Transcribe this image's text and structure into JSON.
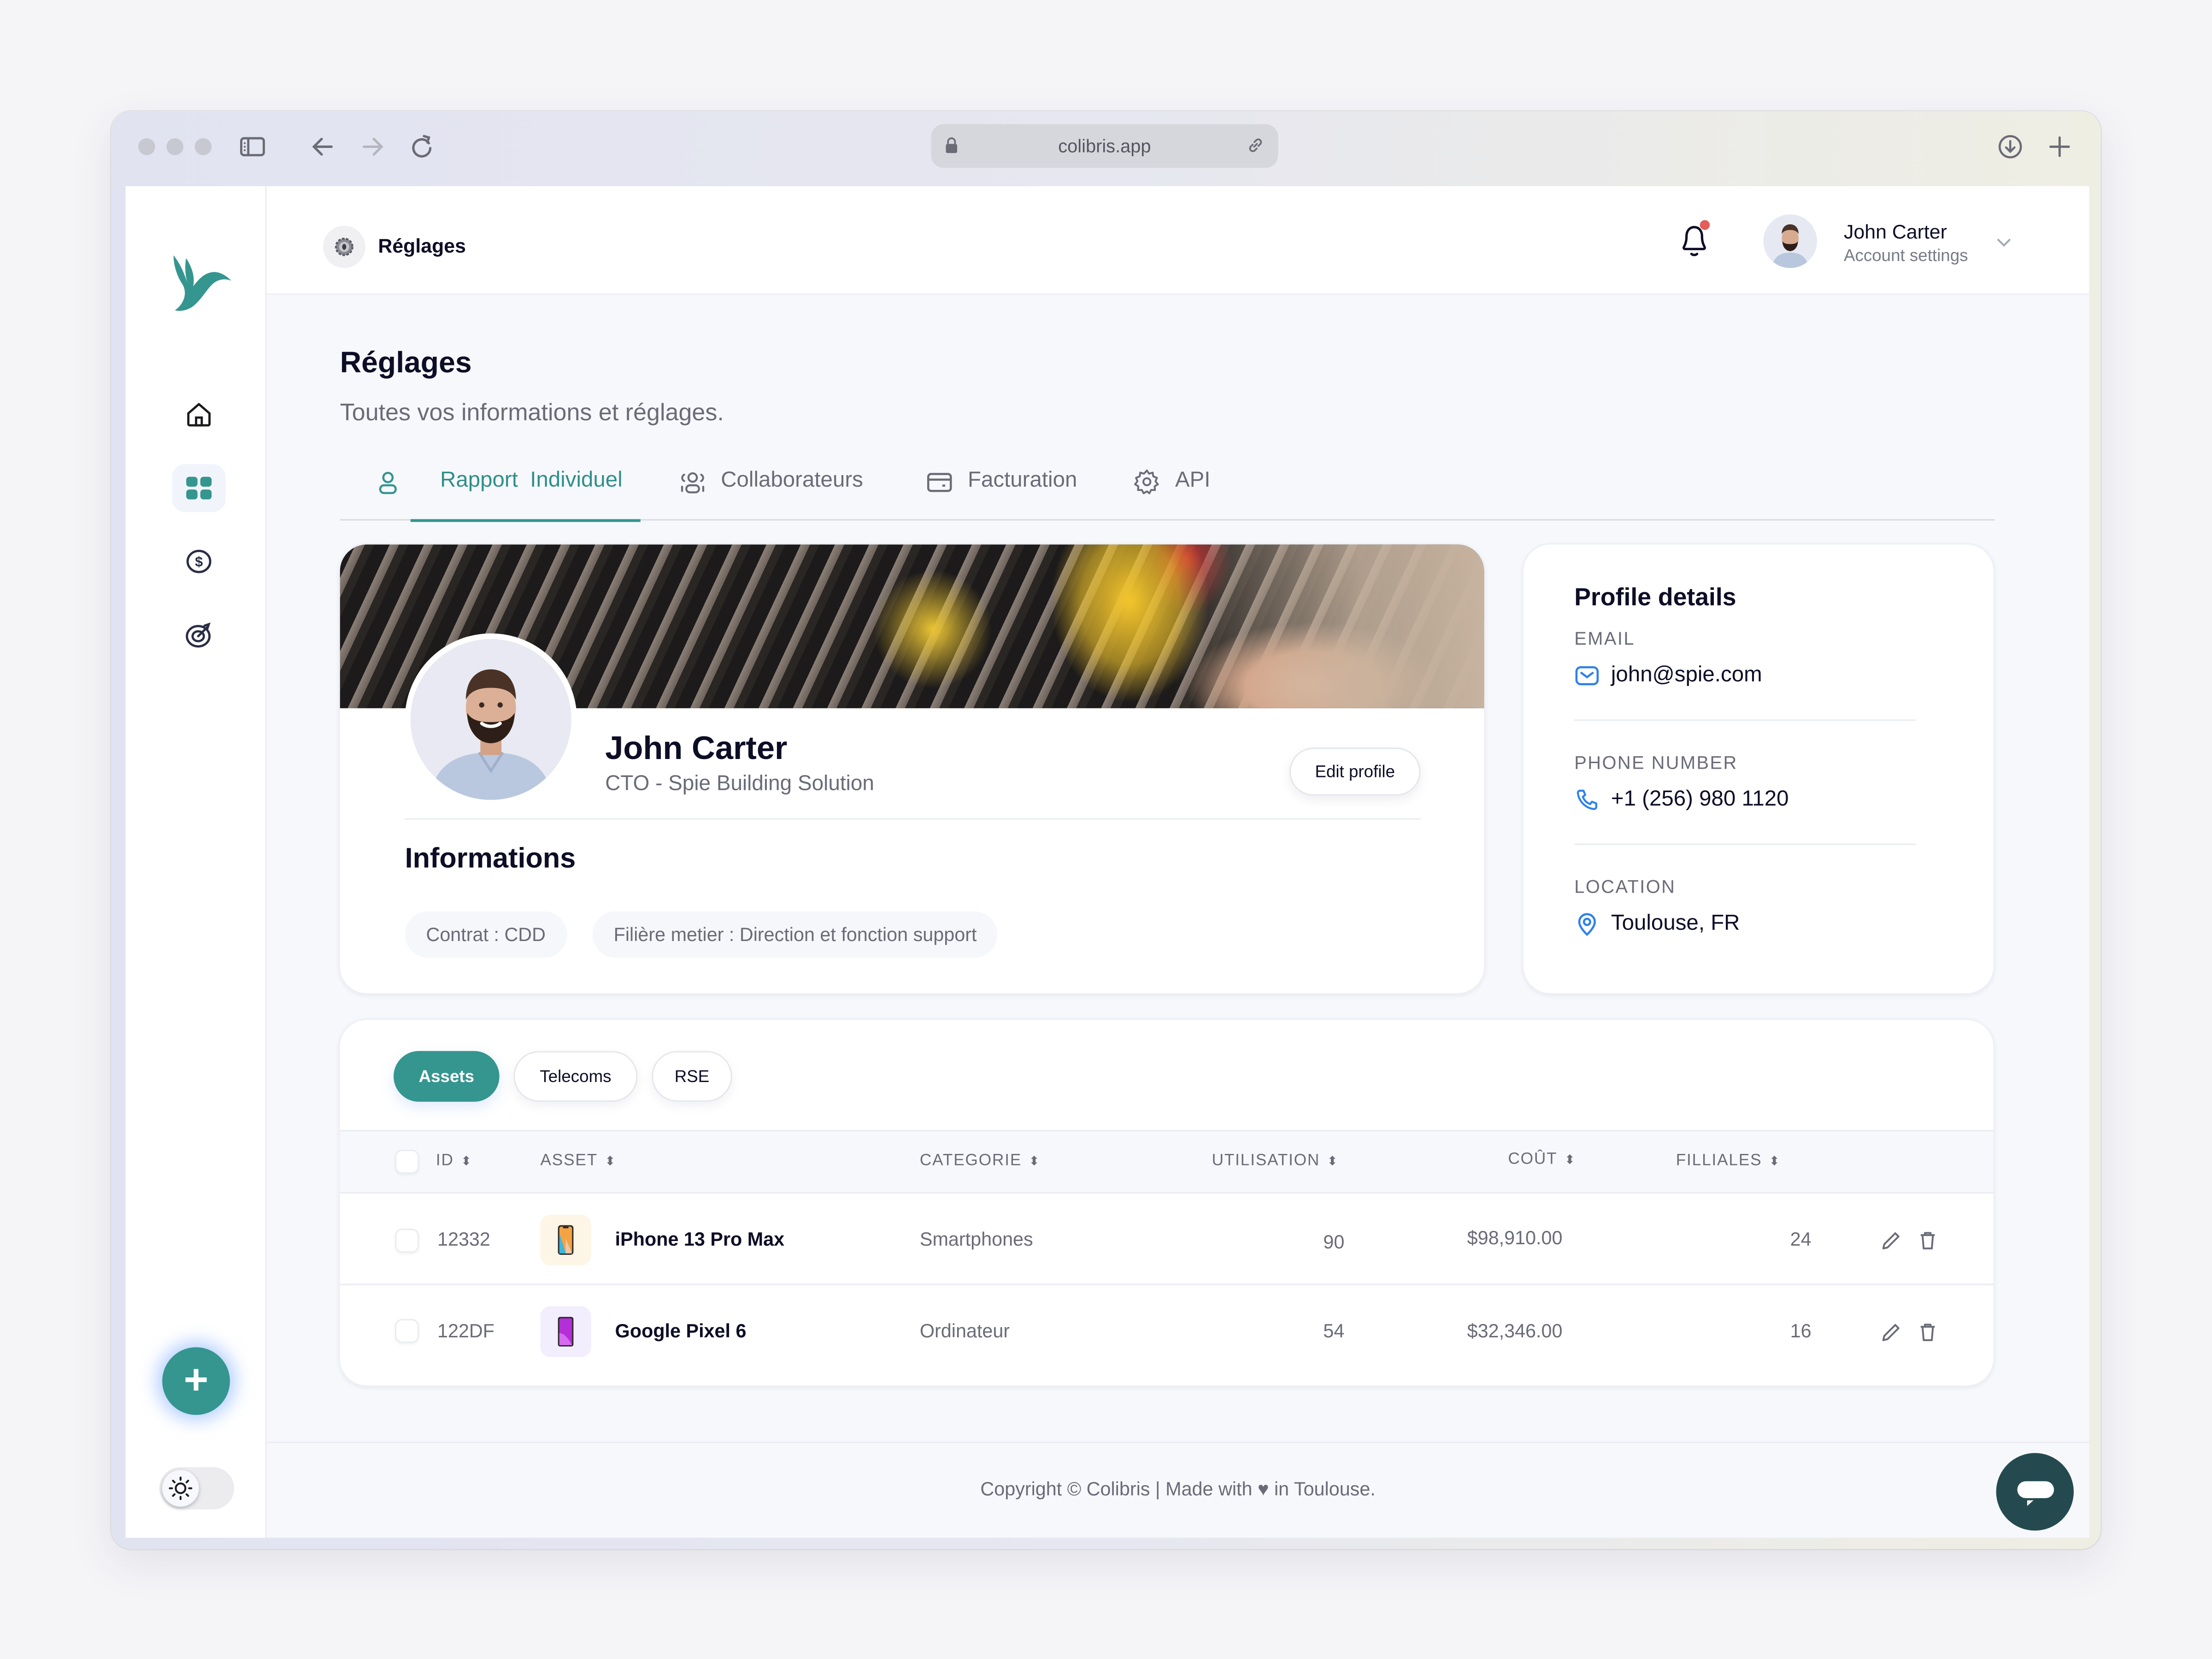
{
  "browser": {
    "url": "colibris.app",
    "icons": [
      "sidebar-toggle-icon",
      "back-arrow-icon",
      "forward-arrow-icon",
      "reload-icon",
      "lock-icon",
      "link-icon",
      "download-icon",
      "new-tab-icon"
    ]
  },
  "sidebar": {
    "logo": "colibris-hummingbird-logo",
    "items": [
      {
        "name": "home",
        "icon": "home-icon",
        "active": false
      },
      {
        "name": "dashboard",
        "icon": "grid-icon",
        "active": true
      },
      {
        "name": "finance",
        "icon": "dollar-icon",
        "active": false
      },
      {
        "name": "goals",
        "icon": "target-icon",
        "active": false
      }
    ],
    "fab_label": "+",
    "theme_toggle": "light"
  },
  "topbar": {
    "breadcrumb": "Réglages",
    "notifications_unread": true,
    "user": {
      "name": "John Carter",
      "subtitle": "Account settings"
    }
  },
  "page": {
    "title": "Réglages",
    "subtitle": "Toutes vos informations et réglages."
  },
  "tabs": [
    {
      "label": "Rapport  Individuel",
      "icon": "user-icon",
      "active": true
    },
    {
      "label": "Collaborateurs",
      "icon": "users-icon",
      "active": false
    },
    {
      "label": "Facturation",
      "icon": "credit-card-icon",
      "active": false
    },
    {
      "label": "API",
      "icon": "gear-icon",
      "active": false
    }
  ],
  "profile": {
    "name": "John Carter",
    "role": "CTO - Spie Building Solution",
    "edit_label": "Edit profile",
    "informations_title": "Informations",
    "chips": [
      "Contrat : CDD",
      "Filière metier : Direction et fonction support"
    ]
  },
  "details": {
    "title": "Profile details",
    "email_label": "EMAIL",
    "email": "john@spie.com",
    "phone_label": "PHONE NUMBER",
    "phone": "+1 (256) 980 1120",
    "location_label": "LOCATION",
    "location": "Toulouse, FR",
    "icon_color": "#2f80ed"
  },
  "table": {
    "filters": [
      {
        "label": "Assets",
        "active": true
      },
      {
        "label": "Telecoms",
        "active": false
      },
      {
        "label": "RSE",
        "active": false
      }
    ],
    "columns": [
      "ID",
      "ASSET",
      "CATEGORIE",
      "UTILISATION",
      "COÛT",
      "FILLIALES"
    ],
    "sort_glyph": "⬍",
    "rows": [
      {
        "id": "12332",
        "asset": "iPhone 13 Pro Max",
        "category": "Smartphones",
        "usage": "90",
        "cost": "$98,910.00",
        "subsidiaries": "24"
      },
      {
        "id": "122DF",
        "asset": "Google Pixel 6",
        "category": "Ordinateur",
        "usage": "54",
        "cost": "$32,346.00",
        "subsidiaries": "16"
      }
    ]
  },
  "footer": {
    "text": "Copyright © Colibris | Made with ♥ in Toulouse."
  },
  "colors": {
    "accent": "#35958f",
    "text_dark": "#0d0d26",
    "text_muted": "#6b6b78",
    "notification": "#e35d5b",
    "chat_button": "#244a4f"
  }
}
